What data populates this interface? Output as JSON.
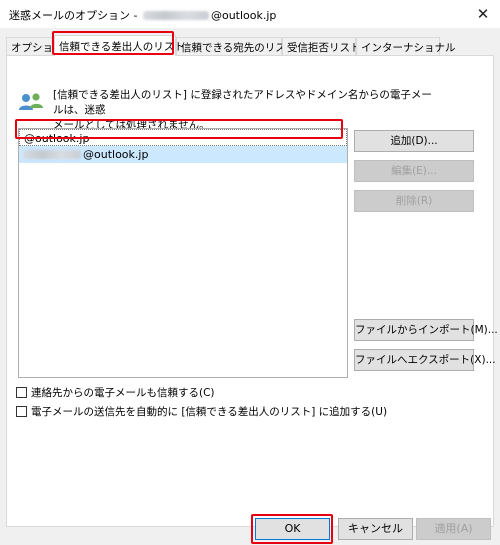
{
  "window": {
    "title_prefix": "迷惑メールのオプション - ",
    "title_suffix": "@outlook.jp",
    "close_glyph": "✕"
  },
  "tabs": [
    {
      "label": "オプション"
    },
    {
      "label": "信頼できる差出人のリスト",
      "active": true
    },
    {
      "label": "信頼できる宛先のリスト"
    },
    {
      "label": "受信拒否リスト"
    },
    {
      "label": "インターナショナル"
    }
  ],
  "description": {
    "line1": "[信頼できる差出人のリスト] に登録されたアドレスやドメイン名からの電子メールは、迷惑",
    "line2": "メールとしては処理されません。",
    "icon": "people-icon"
  },
  "list": {
    "items": [
      {
        "text": "@outlook.jp"
      },
      {
        "text": "@outlook.jp",
        "redacted": true
      }
    ]
  },
  "side_buttons": {
    "add": "追加(D)...",
    "edit": "編集(E)...",
    "remove": "削除(R)",
    "import": "ファイルからインポート(M)...",
    "export": "ファイルへエクスポート(X)..."
  },
  "checkboxes": {
    "trust_contacts": "連絡先からの電子メールも信頼する(C)",
    "auto_add_recipients": "電子メールの送信先を自動的に [信頼できる差出人のリスト] に追加する(U)"
  },
  "footer": {
    "ok": "OK",
    "cancel": "キャンセル",
    "apply": "適用(A)"
  },
  "colors": {
    "highlight_frame": "#e60012",
    "selection": "#cce8ff"
  }
}
